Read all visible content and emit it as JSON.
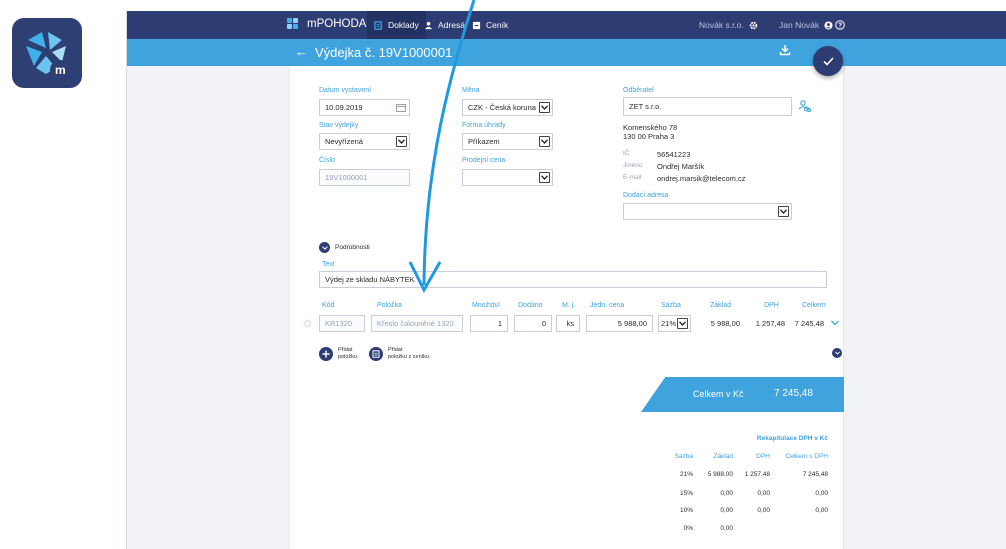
{
  "topbar": {
    "brand": "mPOHODA",
    "nav": [
      {
        "label": "Doklady"
      },
      {
        "label": "Adresář"
      },
      {
        "label": "Ceník"
      }
    ],
    "company": "Novák s.r.o.",
    "user": "Jan Novák"
  },
  "subbar": {
    "back": "←",
    "title": "Výdejka č. 19V1000001"
  },
  "form": {
    "datum_label": "Datum vystavení",
    "datum_value": "10.09.2019",
    "stav_label": "Stav výdejky",
    "stav_value": "Nevyřízená",
    "cislo_label": "Číslo",
    "cislo_value": "19V1000001",
    "mena_label": "Měna",
    "mena_value": "CZK - Česká koruna",
    "forma_label": "Forma úhrady",
    "forma_value": "Příkazem",
    "prodejni_label": "Prodejní cena",
    "prodejni_value": "",
    "odberatel_label": "Odběratel",
    "odberatel_value": "ZET s.r.o.",
    "address_line1": "Komenského 78",
    "address_line2": "130 00 Praha 3",
    "ic_label": "IČ",
    "ic_value": "56541223",
    "jmeno_label": "Jméno",
    "jmeno_value": "Ondřej Maršík",
    "email_label": "E-mail",
    "email_value": "ondrej.marsik@telecom.cz",
    "dodaci_label": "Dodací adresa",
    "dodaci_value": ""
  },
  "details": {
    "toggle_label": "Podrobnosti",
    "text_label": "Text",
    "text_value": "Výdej ze skladu NÁBYTEK"
  },
  "items": {
    "headers": [
      "Kód",
      "Položka",
      "Množství",
      "Dodáno",
      "M. j.",
      "Jedn. cena",
      "Sazba",
      "Základ",
      "DPH",
      "Celkem"
    ],
    "row": {
      "kod": "KR1320",
      "polozka": "Křeslo čalouněné 1320",
      "mnozstvi": "1",
      "dodano": "0",
      "mj": "ks",
      "cena": "5 988,00",
      "sazba": "21%",
      "zaklad": "5 988,00",
      "dph": "1 257,48",
      "celkem": "7 245,48"
    },
    "add_item_l1": "Přidat",
    "add_item_l2": "položku",
    "add_price_l1": "Přidat",
    "add_price_l2": "položku z ceníku"
  },
  "total": {
    "label": "Celkem v Kč",
    "value": "7 245,48"
  },
  "recap": {
    "title": "Rekapitulace DPH v Kč",
    "headers": [
      "Sazba",
      "Základ",
      "DPH",
      "Celkem s DPH"
    ],
    "rows": [
      {
        "sazba": "21%",
        "zaklad": "5 988,00",
        "dph": "1 257,48",
        "celkem": "7 245,48"
      },
      {
        "sazba": "15%",
        "zaklad": "0,00",
        "dph": "0,00",
        "celkem": "0,00"
      },
      {
        "sazba": "10%",
        "zaklad": "0,00",
        "dph": "0,00",
        "celkem": "0,00"
      },
      {
        "sazba": "0%",
        "zaklad": "0,00",
        "dph": "",
        "celkem": ""
      }
    ]
  },
  "colors": {
    "navy": "#2d3c73",
    "blue": "#3fa3dd"
  }
}
